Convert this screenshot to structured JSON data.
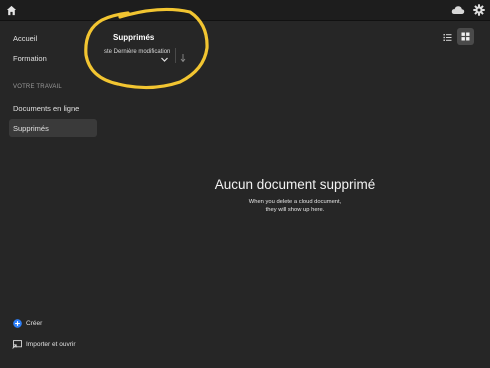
{
  "topbar": {
    "icons": [
      "home-icon",
      "cloud-icon",
      "gear-icon"
    ]
  },
  "sidebar": {
    "items": [
      {
        "label": "Accueil"
      },
      {
        "label": "Formation"
      }
    ],
    "section_label": "VOTRE TRAVAIL",
    "work_items": [
      {
        "label": "Documents en ligne"
      },
      {
        "label": "Supprimés",
        "active": true
      }
    ],
    "actions": [
      {
        "label": "Créer",
        "icon": "plus-circle-icon"
      },
      {
        "label": "Importer et ouvrir",
        "icon": "import-icon"
      }
    ]
  },
  "main": {
    "title": "Supprimés",
    "sort_label": "ste Dernière modification",
    "empty_title": "Aucun document supprimé",
    "empty_line1": "When you delete a cloud document,",
    "empty_line2": "they will show up here."
  },
  "colors": {
    "background": "#262626",
    "topbar": "#1d1d1d",
    "active_item": "#3a3a3a",
    "annotation": "#f2c531",
    "accent_blue": "#2d7ff9"
  }
}
